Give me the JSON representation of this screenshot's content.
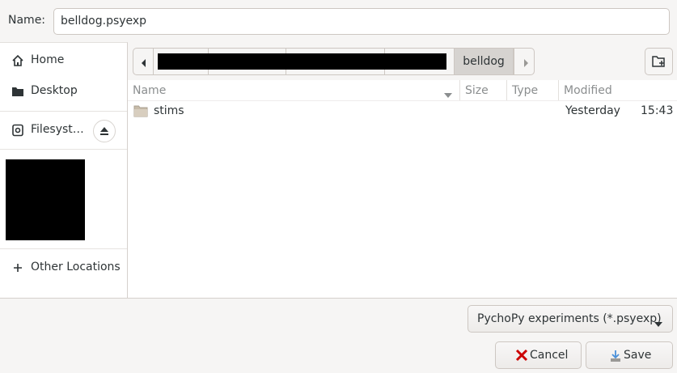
{
  "dialog": {
    "name_label": "Name:",
    "name_value": "belldog.psyexp"
  },
  "sidebar": {
    "items": [
      {
        "label": "Home",
        "icon": "home-icon"
      },
      {
        "label": "Desktop",
        "icon": "folder-icon"
      },
      {
        "label": "Filesyst…",
        "icon": "drive-icon"
      },
      {
        "label": "Other Locations",
        "icon": "plus-icon"
      }
    ]
  },
  "pathbar": {
    "current": "belldog"
  },
  "filelist": {
    "columns": [
      "Name",
      "Size",
      "Type",
      "Modified"
    ],
    "rows": [
      {
        "name": "stims",
        "size": "",
        "type": "",
        "modified_day": "Yesterday",
        "modified_time": "15:43"
      }
    ]
  },
  "filter": {
    "selected": "PychoPy experiments (*.psyexp)"
  },
  "buttons": {
    "cancel": "Cancel",
    "save": "Save"
  },
  "colors": {
    "accent_cancel": "#cc0000",
    "save_icon": "#4a90d9"
  }
}
